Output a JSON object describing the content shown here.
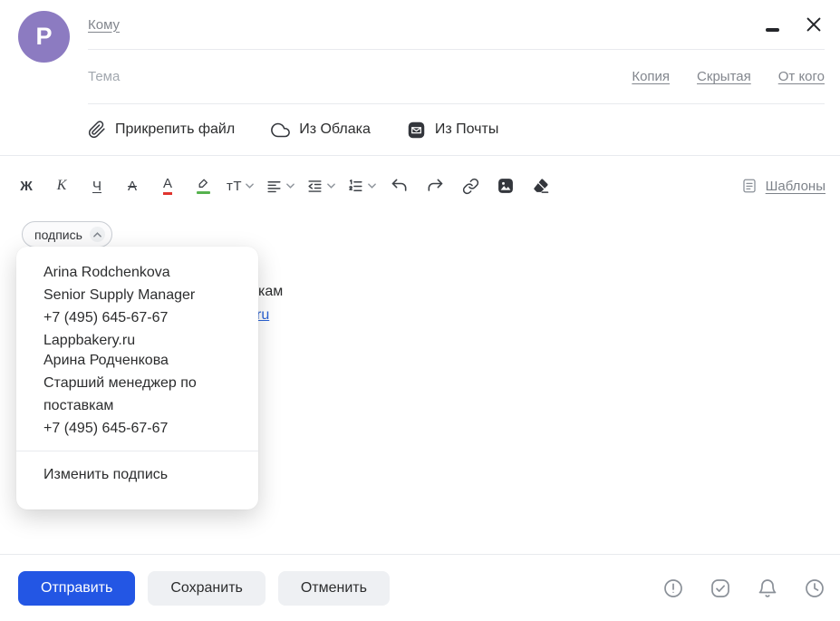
{
  "colors": {
    "accent_blue": "#2356e4",
    "avatar_purple": "#8c7bc1",
    "link_gray": "#82868d",
    "text_dark": "#2c2d2e",
    "text_color_mark_red": "#e0342f",
    "highlight_mark_green": "#56b24e",
    "body_link_blue": "#2b63d6"
  },
  "avatar": {
    "letter": "P"
  },
  "header": {
    "to_label": "Кому",
    "subject_placeholder": "Тема",
    "cc_label": "Копия",
    "bcc_label": "Скрытая",
    "from_label": "От кого"
  },
  "attach_bar": {
    "attach_file": "Прикрепить файл",
    "from_cloud": "Из Облака",
    "from_mail": "Из Почты"
  },
  "format_bar": {
    "bold": "Ж",
    "italic": "К",
    "underline": "Ч",
    "strikethrough": "А",
    "text_color": "А",
    "font_size": "тТ",
    "templates": "Шаблоны"
  },
  "signature": {
    "chip_label": "подпись",
    "options": [
      {
        "lines": [
          "Arina Rodchenkova",
          "Senior Supply Manager",
          "+7 (495) 645-67-67",
          "Lappbakery.ru"
        ]
      },
      {
        "lines": [
          "Арина Родченкова",
          "Старший менеджер по поставкам",
          "+7 (495) 645-67-67"
        ]
      }
    ],
    "edit_label": "Изменить подпись"
  },
  "body": {
    "visible_fragment_1": "кам",
    "visible_fragment_2": "ru"
  },
  "footer": {
    "send": "Отправить",
    "save": "Сохранить",
    "cancel": "Отменить"
  }
}
